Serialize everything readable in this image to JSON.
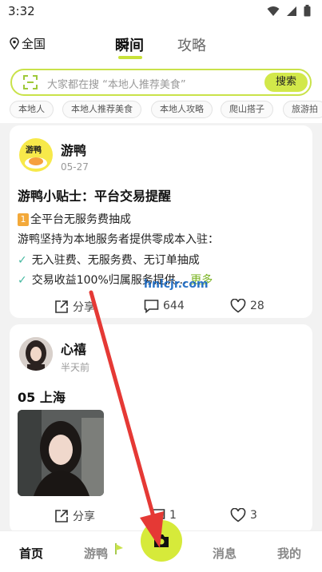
{
  "status": {
    "time": "3:32"
  },
  "header": {
    "location": "全国",
    "tabs": [
      {
        "label": "瞬间"
      },
      {
        "label": "攻略"
      }
    ]
  },
  "search": {
    "placeholder": "大家都在搜 “本地人推荐美食”",
    "button": "搜索"
  },
  "chips": [
    "本地人",
    "本地人推荐美食",
    "本地人攻略",
    "爬山搭子",
    "旅游拍"
  ],
  "posts": [
    {
      "author": "游鸭",
      "avatar_text": "游鸭",
      "date": "05-27",
      "title": "游鸭小贴士：平台交易提醒",
      "lines": [
        {
          "badge": "1",
          "text": "全平台无服务费抽成"
        },
        {
          "text": "游鸭坚持为本地服务者提供零成本入驻："
        },
        {
          "check": "✓",
          "text": "无入驻费、无服务费、无订单抽成"
        },
        {
          "check": "✓",
          "text": "交易收益100%归属服务提供…",
          "more": "更多"
        }
      ],
      "share": "分享",
      "comments": "644",
      "likes": "28"
    },
    {
      "author": "心禧",
      "date": "半天前",
      "title": "05 上海",
      "share": "分享",
      "comments": "1",
      "likes": "3"
    }
  ],
  "bottom_nav": [
    "首页",
    "游鸭",
    "消息",
    "我的"
  ],
  "watermark": "hnlcjr.com",
  "colors": {
    "accent": "#d2e84a",
    "arrow": "#e53935",
    "check": "#45b8a0"
  }
}
